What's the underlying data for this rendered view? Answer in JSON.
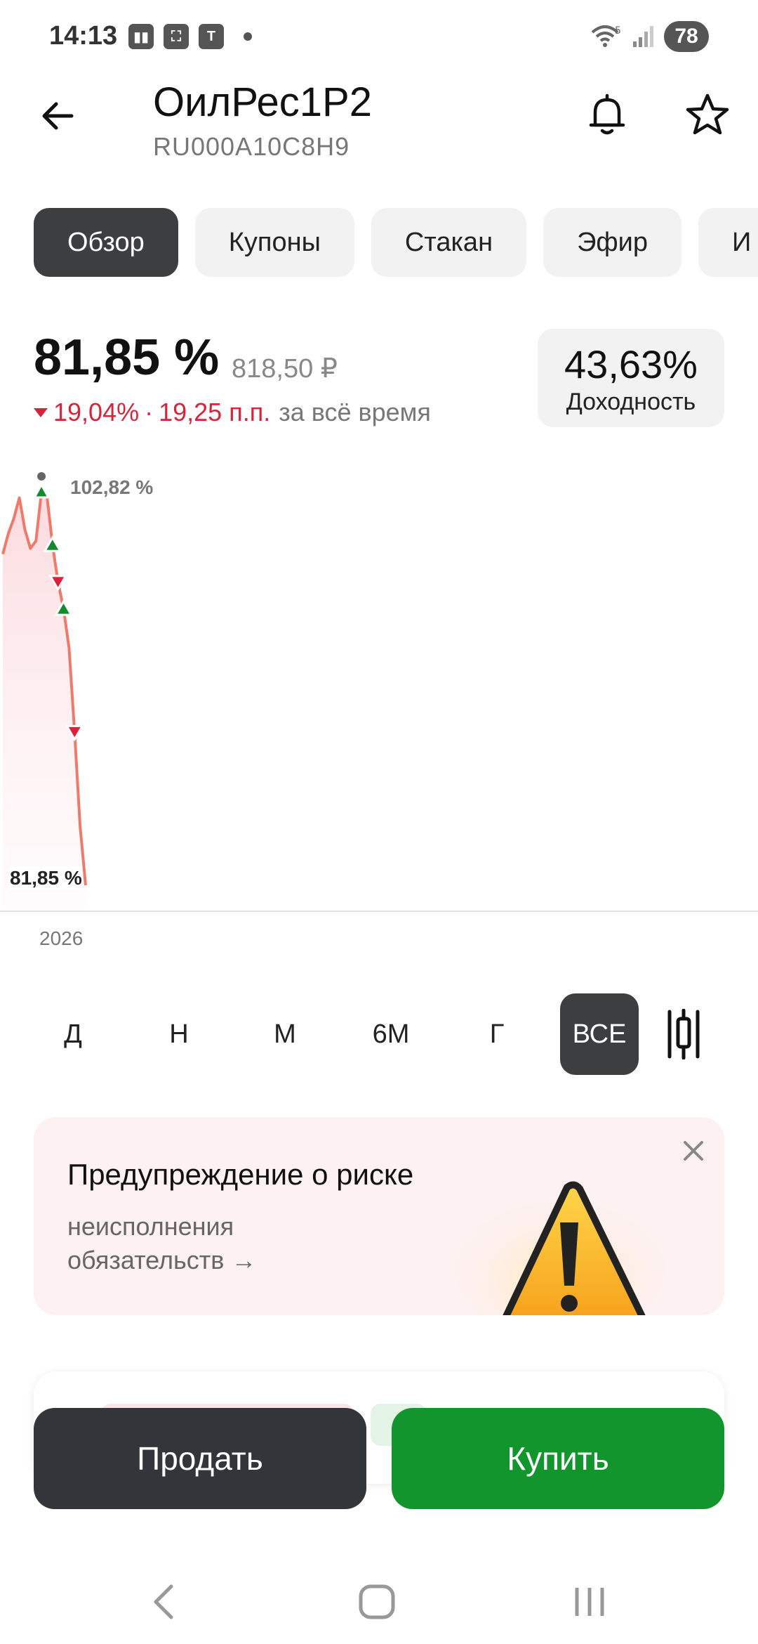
{
  "status_bar": {
    "time": "14:13",
    "battery": "78",
    "left_icons": [
      "gallery-icon",
      "screenshot-icon",
      "shield-t-icon",
      "dot-icon"
    ],
    "right_icons": [
      "wifi-5-icon",
      "signal-icon"
    ]
  },
  "header": {
    "title": "ОилРес1Р2",
    "isin": "RU000A10C8H9",
    "icons": [
      "back-arrow-icon",
      "bell-icon",
      "star-icon"
    ]
  },
  "tabs": [
    {
      "label": "Обзор",
      "active": true
    },
    {
      "label": "Купоны",
      "active": false
    },
    {
      "label": "Стакан",
      "active": false
    },
    {
      "label": "Эфир",
      "active": false
    },
    {
      "label": "И",
      "active": false
    }
  ],
  "price": {
    "percent": "81,85 %",
    "rub": "818,50 ₽",
    "change_percent": "19,04%",
    "separator": "·",
    "change_pp": "19,25 п.п.",
    "change_period": "за всё время",
    "change_color": "#d6243a"
  },
  "yield": {
    "value": "43,63%",
    "label": "Доходность"
  },
  "chart": {
    "max_label": "102,82 %",
    "min_label": "81,85 %",
    "x_label": "2026",
    "line_color": "#ef7a6a",
    "fill_color": "#fde3e6"
  },
  "chart_data": {
    "type": "area",
    "x_tick_labels": [
      "2026"
    ],
    "y": [
      99.5,
      100.6,
      101.4,
      102.5,
      100.8,
      99.8,
      100.2,
      102.82,
      102.6,
      100.0,
      98.0,
      96.6,
      94.5,
      90.0,
      85.0,
      81.85
    ],
    "max_value": 102.82,
    "min_value": 81.85,
    "markers": [
      {
        "index": 7,
        "type": "max"
      },
      {
        "index": 9,
        "type": "up"
      },
      {
        "index": 10,
        "type": "down"
      },
      {
        "index": 11,
        "type": "up"
      },
      {
        "index": 13,
        "type": "down"
      }
    ],
    "grid": false
  },
  "periods": [
    {
      "label": "Д",
      "active": false
    },
    {
      "label": "Н",
      "active": false
    },
    {
      "label": "М",
      "active": false
    },
    {
      "label": "6М",
      "active": false
    },
    {
      "label": "Г",
      "active": false
    },
    {
      "label": "ВСЕ",
      "active": true
    }
  ],
  "risk": {
    "title": "Предупреждение о риске",
    "subtitle": "неисполнения обязательств →",
    "icons": [
      "close-icon",
      "warning-triangle-icon"
    ],
    "bg_color": "#fdf1f2"
  },
  "actions": {
    "sell": "Продать",
    "buy": "Купить",
    "sell_color": "#32353a",
    "buy_color": "#13952d"
  },
  "nav": {
    "icons": [
      "nav-back-icon",
      "nav-home-icon",
      "nav-recents-icon"
    ]
  }
}
